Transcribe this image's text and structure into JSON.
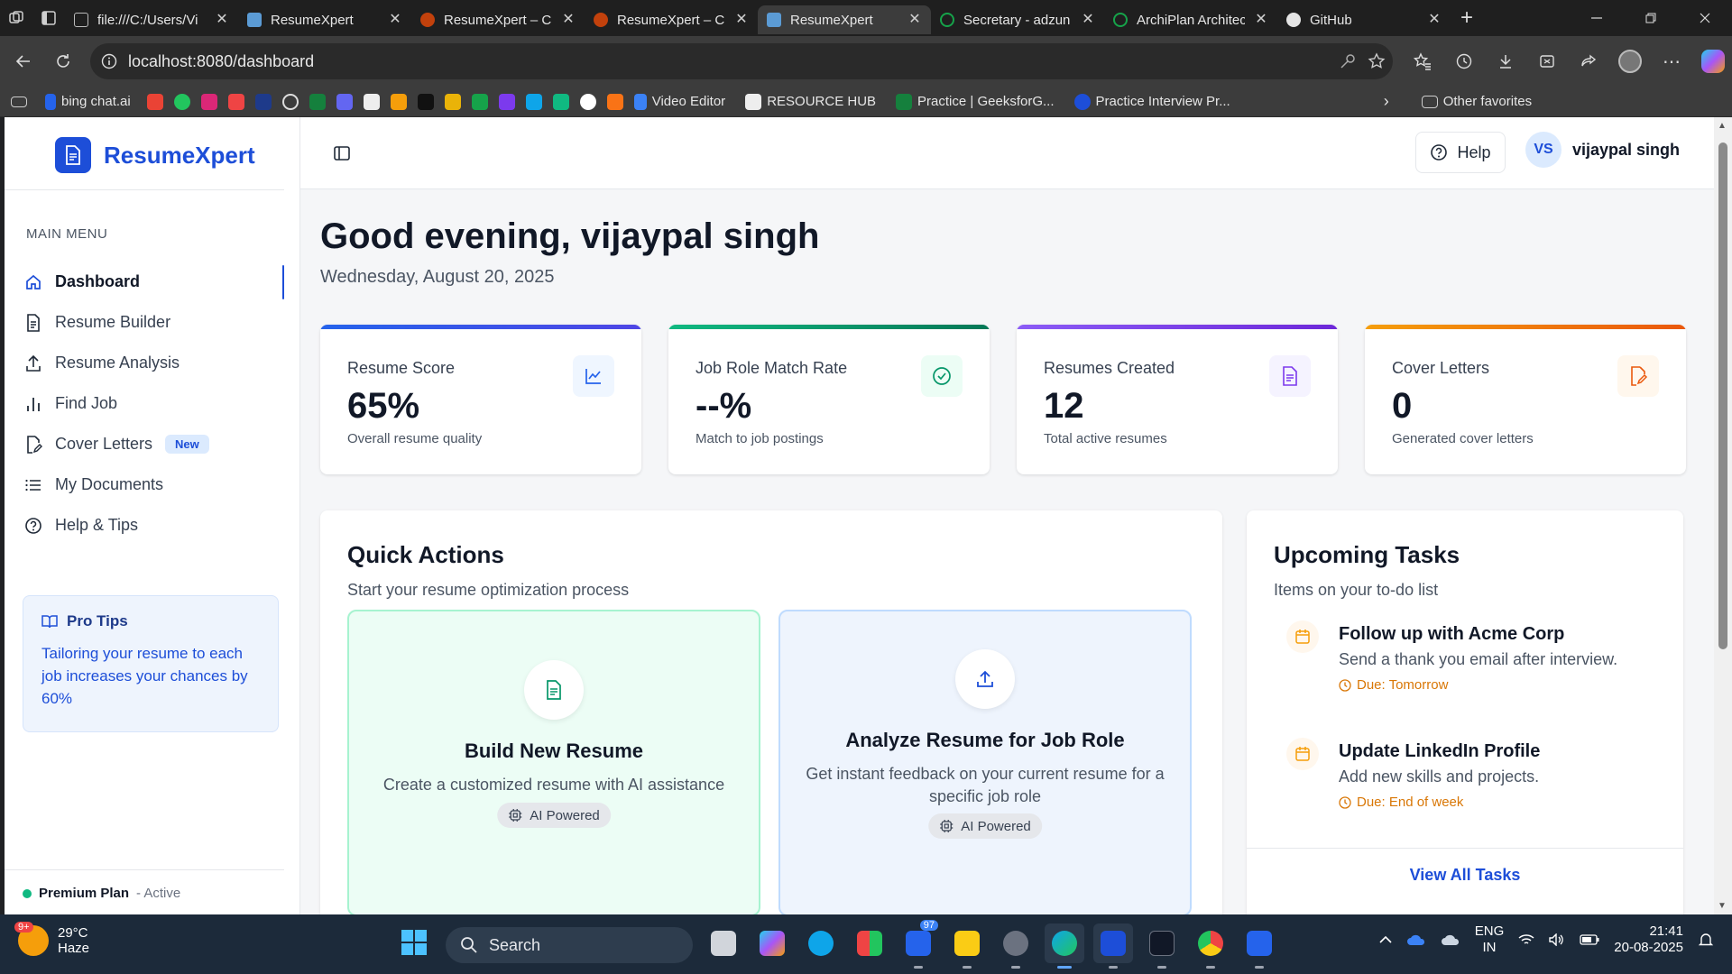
{
  "browser": {
    "tabs": [
      {
        "title": "file:///C:/Users/Vi",
        "active": false
      },
      {
        "title": "ResumeXpert",
        "active": false
      },
      {
        "title": "ResumeXpert – Cl",
        "active": false
      },
      {
        "title": "ResumeXpert – Cl",
        "active": false
      },
      {
        "title": "ResumeXpert",
        "active": true
      },
      {
        "title": "Secretary - adzun",
        "active": false
      },
      {
        "title": "ArchiPlan Architec",
        "active": false
      },
      {
        "title": "GitHub",
        "active": false
      }
    ],
    "url": "localhost:8080/dashboard",
    "favorites": [
      {
        "label": "bing chat.ai"
      },
      {
        "label": "Video Editor"
      },
      {
        "label": "RESOURCE HUB"
      },
      {
        "label": "Practice | GeeksforG..."
      },
      {
        "label": "Practice Interview Pr..."
      }
    ],
    "other_favorites": "Other favorites"
  },
  "app": {
    "brand": "ResumeXpert",
    "menu_heading": "MAIN MENU",
    "menu": [
      {
        "label": "Dashboard",
        "icon": "home-icon",
        "active": true
      },
      {
        "label": "Resume Builder",
        "icon": "document-icon"
      },
      {
        "label": "Resume Analysis",
        "icon": "upload-icon"
      },
      {
        "label": "Find Job",
        "icon": "bar-chart-icon"
      },
      {
        "label": "Cover Letters",
        "icon": "edit-document-icon",
        "badge": "New"
      },
      {
        "label": "My Documents",
        "icon": "list-icon"
      },
      {
        "label": "Help & Tips",
        "icon": "help-circle-icon"
      }
    ],
    "pro_tips": {
      "title": "Pro Tips",
      "text": "Tailoring your resume to each job increases your chances by 60%"
    },
    "plan": {
      "name": "Premium Plan",
      "status": "- Active"
    }
  },
  "header": {
    "help": "Help",
    "avatar_initials": "VS",
    "user_name": "vijaypal singh"
  },
  "main": {
    "greeting": "Good evening, vijaypal singh",
    "date": "Wednesday, August 20, 2025",
    "stats": [
      {
        "label": "Resume Score",
        "value": "65%",
        "sub": "Overall resume quality",
        "icon": "line-chart-icon",
        "color": "#2563eb"
      },
      {
        "label": "Job Role Match Rate",
        "value": "--%",
        "sub": "Match to job postings",
        "icon": "check-circle-icon",
        "color": "#059669"
      },
      {
        "label": "Resumes Created",
        "value": "12",
        "sub": "Total active resumes",
        "icon": "document-icon",
        "color": "#7c3aed"
      },
      {
        "label": "Cover Letters",
        "value": "0",
        "sub": "Generated cover letters",
        "icon": "edit-document-icon",
        "color": "#ea580c"
      }
    ],
    "quick_actions": {
      "title": "Quick Actions",
      "subtitle": "Start your resume optimization process",
      "actions": [
        {
          "title": "Build New Resume",
          "desc": "Create a customized resume with AI assistance",
          "pill": "AI Powered"
        },
        {
          "title": "Analyze Resume for Job Role",
          "desc": "Get instant feedback on your current resume for a specific job role",
          "pill": "AI Powered"
        }
      ]
    },
    "tasks": {
      "title": "Upcoming Tasks",
      "subtitle": "Items on your to-do list",
      "items": [
        {
          "title": "Follow up with Acme Corp",
          "desc": "Send a thank you email after interview.",
          "due": "Due: Tomorrow"
        },
        {
          "title": "Update LinkedIn Profile",
          "desc": "Add new skills and projects.",
          "due": "Due: End of week"
        }
      ],
      "view_all": "View All Tasks"
    }
  },
  "taskbar": {
    "weather_temp": "29°C",
    "weather_desc": "Haze",
    "weather_badge": "9+",
    "search": "Search",
    "mail_badge": "97",
    "lang_1": "ENG",
    "lang_2": "IN",
    "time": "21:41",
    "date": "20-08-2025"
  }
}
